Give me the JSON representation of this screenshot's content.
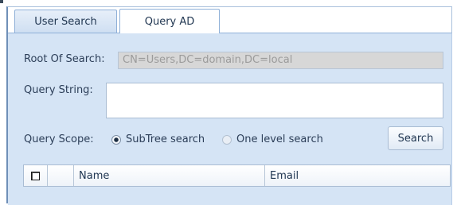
{
  "tabs": [
    {
      "label": "User Search",
      "active": false
    },
    {
      "label": "Query AD",
      "active": true
    }
  ],
  "form": {
    "root_label": "Root Of Search:",
    "root_value": "CN=Users,DC=domain,DC=local",
    "query_label": "Query String:",
    "query_value": "",
    "scope_label": "Query Scope:",
    "scope_options": [
      {
        "label": "SubTree search",
        "selected": true
      },
      {
        "label": "One level search",
        "selected": false
      }
    ],
    "search_button": "Search"
  },
  "grid": {
    "columns": [
      "Name",
      "Email"
    ],
    "select_all_checked": false
  },
  "colors": {
    "panel_background": "#d5e4f5",
    "tab_border": "#8fb0d8",
    "text": "#2c3e58"
  }
}
